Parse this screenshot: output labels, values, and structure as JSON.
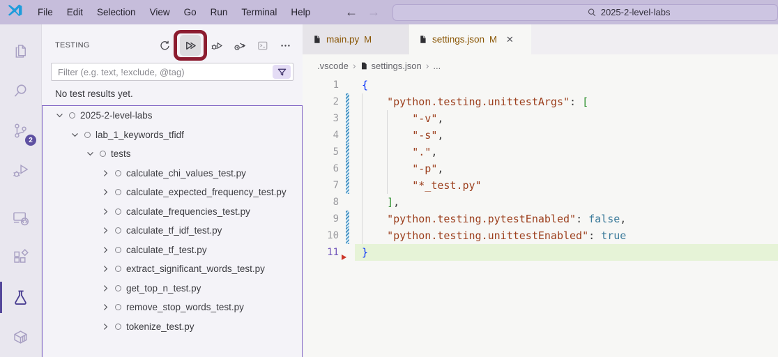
{
  "titlebar": {
    "menus": [
      "File",
      "Edit",
      "Selection",
      "View",
      "Go",
      "Run",
      "Terminal",
      "Help"
    ],
    "back_arrow": "←",
    "forward_arrow": "→",
    "search": "2025-2-level-labs"
  },
  "activitybar": {
    "scm_badge": "2",
    "items": [
      "explorer",
      "search",
      "source-control",
      "run-and-debug",
      "remote-explorer",
      "extensions",
      "testing",
      "containers"
    ],
    "active_item": "testing"
  },
  "sidebar": {
    "title": "TESTING",
    "actions": [
      "refresh-tests",
      "run-tests",
      "debug-tests",
      "run-tests-with-coverage",
      "show-output",
      "more-actions"
    ],
    "filter_placeholder": "Filter (e.g. text, !exclude, @tag)",
    "status": "No test results yet.",
    "tree": [
      {
        "label": "2025-2-level-labs",
        "level": 0,
        "expanded": true
      },
      {
        "label": "lab_1_keywords_tfidf",
        "level": 1,
        "expanded": true
      },
      {
        "label": "tests",
        "level": 2,
        "expanded": true
      },
      {
        "label": "calculate_chi_values_test.py",
        "level": 3,
        "expanded": false
      },
      {
        "label": "calculate_expected_frequency_test.py",
        "level": 3,
        "expanded": false
      },
      {
        "label": "calculate_frequencies_test.py",
        "level": 3,
        "expanded": false
      },
      {
        "label": "calculate_tf_idf_test.py",
        "level": 3,
        "expanded": false
      },
      {
        "label": "calculate_tf_test.py",
        "level": 3,
        "expanded": false
      },
      {
        "label": "extract_significant_words_test.py",
        "level": 3,
        "expanded": false
      },
      {
        "label": "get_top_n_test.py",
        "level": 3,
        "expanded": false
      },
      {
        "label": "remove_stop_words_test.py",
        "level": 3,
        "expanded": false
      },
      {
        "label": "tokenize_test.py",
        "level": 3,
        "expanded": false
      }
    ]
  },
  "editor": {
    "tabs": [
      {
        "name": "main.py",
        "badge": "M",
        "active": false
      },
      {
        "name": "settings.json",
        "badge": "M",
        "active": true,
        "close": "✕"
      }
    ],
    "breadcrumb": [
      ".vscode",
      "settings.json",
      "..."
    ],
    "code": {
      "token_colors": {
        "brace": "#0431fa",
        "bracket": "#319331",
        "key": "#9c3f1d",
        "str": "#9c3f1d",
        "bool": "#3c7b9b",
        "pun": "#3b3b3b"
      },
      "lines": [
        {
          "num": 1,
          "modified": false,
          "highlighted": false,
          "tokens": [
            [
              "brace",
              "{"
            ]
          ]
        },
        {
          "num": 2,
          "modified": true,
          "highlighted": false,
          "tokens": [
            [
              "pun",
              "    "
            ],
            [
              "key",
              "\"python.testing.unittestArgs\""
            ],
            [
              "pun",
              ": "
            ],
            [
              "bracket",
              "["
            ]
          ]
        },
        {
          "num": 3,
          "modified": true,
          "highlighted": false,
          "tokens": [
            [
              "pun",
              "        "
            ],
            [
              "str",
              "\"-v\""
            ],
            [
              "pun",
              ","
            ]
          ]
        },
        {
          "num": 4,
          "modified": true,
          "highlighted": false,
          "tokens": [
            [
              "pun",
              "        "
            ],
            [
              "str",
              "\"-s\""
            ],
            [
              "pun",
              ","
            ]
          ]
        },
        {
          "num": 5,
          "modified": true,
          "highlighted": false,
          "tokens": [
            [
              "pun",
              "        "
            ],
            [
              "str",
              "\".\""
            ],
            [
              "pun",
              ","
            ]
          ]
        },
        {
          "num": 6,
          "modified": true,
          "highlighted": false,
          "tokens": [
            [
              "pun",
              "        "
            ],
            [
              "str",
              "\"-p\""
            ],
            [
              "pun",
              ","
            ]
          ]
        },
        {
          "num": 7,
          "modified": true,
          "highlighted": false,
          "tokens": [
            [
              "pun",
              "        "
            ],
            [
              "str",
              "\"*_test.py\""
            ]
          ]
        },
        {
          "num": 8,
          "modified": false,
          "highlighted": false,
          "tokens": [
            [
              "pun",
              "    "
            ],
            [
              "bracket",
              "]"
            ],
            [
              "pun",
              ","
            ]
          ]
        },
        {
          "num": 9,
          "modified": true,
          "highlighted": false,
          "tokens": [
            [
              "pun",
              "    "
            ],
            [
              "key",
              "\"python.testing.pytestEnabled\""
            ],
            [
              "pun",
              ": "
            ],
            [
              "bool",
              "false"
            ],
            [
              "pun",
              ","
            ]
          ]
        },
        {
          "num": 10,
          "modified": true,
          "highlighted": false,
          "tokens": [
            [
              "pun",
              "    "
            ],
            [
              "key",
              "\"python.testing.unittestEnabled\""
            ],
            [
              "pun",
              ": "
            ],
            [
              "bool",
              "true"
            ]
          ]
        },
        {
          "num": 11,
          "modified": false,
          "highlighted": true,
          "marker": true,
          "tokens": [
            [
              "brace",
              "}"
            ]
          ]
        }
      ]
    }
  },
  "colors": {
    "titlebar_bg": "#c6bddb",
    "activitybar_bg": "#e9e7ef",
    "sidebar_bg": "#f4f3f8",
    "editor_bg": "#f7f7f5",
    "tree_focus_border": "#7e62c4",
    "annotation_red": "#8c1c30",
    "git_modified": "#895503",
    "current_line": "#e6f3d7",
    "scm_badge_bg": "#5f51a2"
  }
}
